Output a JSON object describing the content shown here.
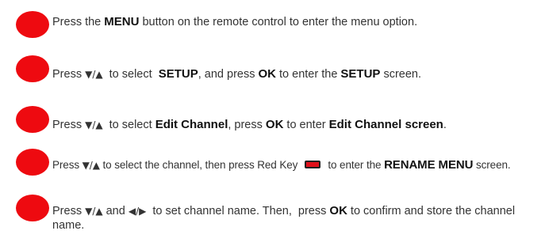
{
  "steps": [
    {
      "pre": "Press the ",
      "b1": "MENU",
      "post": " button on the remote control to enter the menu option."
    },
    {
      "pre": "Press ",
      "sym": "▼/▲",
      "mid1": "  to select  ",
      "b1": "SETUP",
      "mid2": ", and press ",
      "b2": "OK",
      "mid3": " to enter the ",
      "b3": "SETUP",
      "post": " screen."
    },
    {
      "pre": "Press ",
      "sym": "▼/▲",
      "mid1": "  to select ",
      "b1": "Edit Channel",
      "mid2": ", press ",
      "b2": "OK",
      "mid3": " to enter ",
      "b3": "Edit Channel screen",
      "post": "."
    },
    {
      "pre": "Press ",
      "sym": "▼/▲",
      "mid1": " to select the channel, then press Red Key",
      "mid2": "to enter the ",
      "b1": "RENAME MENU",
      "post": " screen."
    },
    {
      "pre": "Press ",
      "sym1": "▼/▲",
      "mid1": " and ",
      "sym2": "◀/▶",
      "mid2": "  to set channel name. Then,  press ",
      "b1": "OK",
      "post": " to confirm and store the channel name."
    }
  ]
}
